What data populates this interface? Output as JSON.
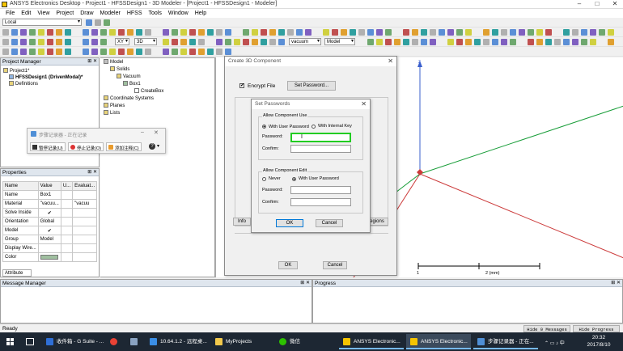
{
  "window": {
    "title": "ANSYS Electronics Desktop - Project1 - HFSSDesign1 - 3D Modeler - [Project1 - HFSSDesign1 - Modeler]",
    "controls": [
      "–",
      "□",
      "✕"
    ]
  },
  "menu": [
    "File",
    "Edit",
    "View",
    "Project",
    "Draw",
    "Modeler",
    "HFSS",
    "Tools",
    "Window",
    "Help"
  ],
  "toolbar": {
    "location": "Local",
    "plane": "XY",
    "dimension": "3D",
    "material": "vacuum",
    "mode": "Model"
  },
  "project_manager": {
    "title": "Project Manager",
    "items": [
      "Project1*",
      "HFSSDesign1 (DrivenModal)*",
      "Definitions"
    ]
  },
  "model_tree": {
    "items": [
      "Model",
      "Solids",
      "Vacuum",
      "Box1",
      "CreateBox",
      "Coordinate Systems",
      "Planes",
      "Lists"
    ]
  },
  "recorder": {
    "title": "步骤记录器 - 正在记录",
    "pause": "暂停记录(U)",
    "stop": "停止记录(O)",
    "comment": "添加注释(C)"
  },
  "properties": {
    "title": "Properties",
    "headers": [
      "Name",
      "Value",
      "U...",
      "Evaluat..."
    ],
    "rows": [
      {
        "name": "Name",
        "value": "Box1",
        "eval": ""
      },
      {
        "name": "Material",
        "value": "\"vacuu...",
        "eval": "\"vacuu"
      },
      {
        "name": "Solve Inside",
        "value": "✔",
        "eval": ""
      },
      {
        "name": "Orientation",
        "value": "Global",
        "eval": ""
      },
      {
        "name": "Model",
        "value": "✔",
        "eval": ""
      },
      {
        "name": "Group",
        "value": "Model",
        "eval": ""
      },
      {
        "name": "Display Wire...",
        "value": "",
        "eval": ""
      },
      {
        "name": "Color",
        "value": "",
        "eval": ""
      }
    ],
    "tab": "Attribute",
    "color_swatch": "#9fbf9f"
  },
  "create_dialog": {
    "title": "Create 3D Component",
    "encrypt_label": "Encrypt File",
    "set_password": "Set Password...",
    "info_tab": "Info",
    "regions_tab": "egions",
    "ok": "OK",
    "cancel": "Cancel"
  },
  "password_dialog": {
    "title": "Set Passwords",
    "use_group": "Allow Component Use",
    "use_user_pw": "With User Password",
    "use_internal_key": "With Internal Key",
    "password_label": "Password:",
    "confirm_label": "Confirm:",
    "edit_group": "Allow Component Edit",
    "never": "Never",
    "edit_user_pw": "With User Password",
    "ok": "OK",
    "cancel": "Cancel",
    "focus_color": "#22cc22"
  },
  "viewport": {
    "axis_z": "z",
    "scale_left": "1",
    "scale_right": "2 (mm)"
  },
  "message_manager": {
    "title": "Message Manager"
  },
  "progress": {
    "title": "Progress"
  },
  "status": {
    "text": "Ready",
    "hide_messages": "Hide 0 Messages",
    "hide_progress": "Hide Progress"
  },
  "taskbar": {
    "tasks": [
      "收件箱 - G Suite - ...",
      "10.64.1.2 - 远程桌...",
      "MyProjects",
      "微信",
      "ANSYS Electronic...",
      "ANSYS Electronic...",
      "步骤记录器 - 正在..."
    ],
    "time": "20:32",
    "date": "2017/8/10"
  }
}
